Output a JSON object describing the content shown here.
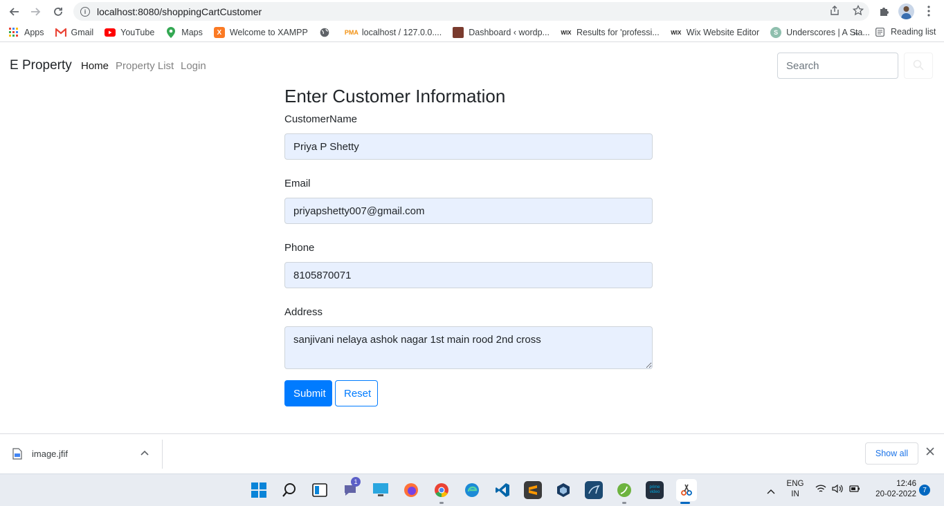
{
  "browser": {
    "url": "localhost:8080/shoppingCartCustomer",
    "bookmarks": [
      {
        "label": "Apps",
        "icon": "apps-grid-icon"
      },
      {
        "label": "Gmail",
        "icon": "gmail-icon"
      },
      {
        "label": "YouTube",
        "icon": "youtube-icon"
      },
      {
        "label": "Maps",
        "icon": "maps-icon"
      },
      {
        "label": "Welcome to XAMPP",
        "icon": "xampp-icon"
      },
      {
        "label": "",
        "icon": "globe-icon"
      },
      {
        "label": "localhost / 127.0.0....",
        "icon": "phpmyadmin-icon"
      },
      {
        "label": "Dashboard ‹ wordp...",
        "icon": "wordpress-icon"
      },
      {
        "label": "Results for 'professi...",
        "icon": "wix-icon"
      },
      {
        "label": "Wix Website Editor",
        "icon": "wix-icon"
      },
      {
        "label": "Underscores | A Sta...",
        "icon": "underscores-icon"
      }
    ],
    "more": "»",
    "reading_list": "Reading list"
  },
  "navbar": {
    "brand": "E Property",
    "links": [
      "Home",
      "Property List",
      "Login"
    ],
    "search_placeholder": "Search"
  },
  "form": {
    "title": "Enter Customer Information",
    "fields": [
      {
        "label": "CustomerName",
        "value": "Priya P Shetty"
      },
      {
        "label": "Email",
        "value": "priyapshetty007@gmail.com"
      },
      {
        "label": "Phone",
        "value": "8105870071"
      },
      {
        "label": "Address",
        "value": "sanjivani nelaya ashok nagar 1st main rood 2nd cross"
      }
    ],
    "submit_label": "Submit",
    "reset_label": "Reset"
  },
  "downloads": {
    "file": "image.jfif",
    "show_all": "Show all"
  },
  "taskbar": {
    "chat_badge": "1",
    "lang": "ENG",
    "region": "IN",
    "time": "12:46",
    "date": "20-02-2022",
    "notifications": "7"
  }
}
